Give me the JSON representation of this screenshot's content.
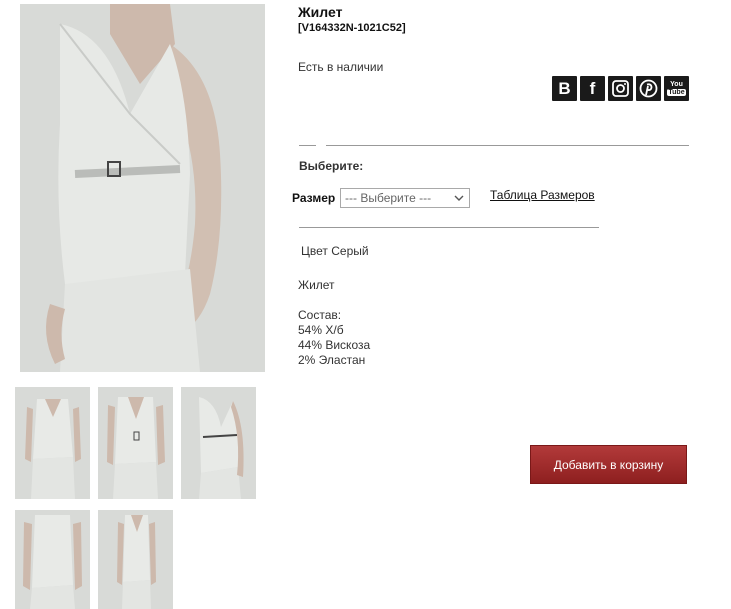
{
  "product": {
    "title": "Жилет",
    "sku": "[V164332N-1021C52]",
    "stock_status": "Есть в наличии",
    "choose_label": "Выберите:",
    "size_label": "Размер",
    "size_select_value": "--- Выберите ---",
    "size_table_link": "Таблица Размеров",
    "color_text": "Цвет Серый",
    "description_name": "Жилет",
    "composition_label": "Состав:",
    "composition": [
      "54% Х/б",
      "44% Вискоза",
      "2% Эластан"
    ],
    "add_to_cart_label": "Добавить в корзину"
  },
  "social": {
    "vk_label": "B",
    "fb_label": "f",
    "yt_top": "You",
    "yt_bottom": "Tube",
    "icons": [
      "vk-icon",
      "facebook-icon",
      "instagram-icon",
      "pinterest-icon",
      "youtube-icon"
    ]
  },
  "colors": {
    "cart_button": "#9e2a2a",
    "social_bg": "#1a1a1a"
  }
}
